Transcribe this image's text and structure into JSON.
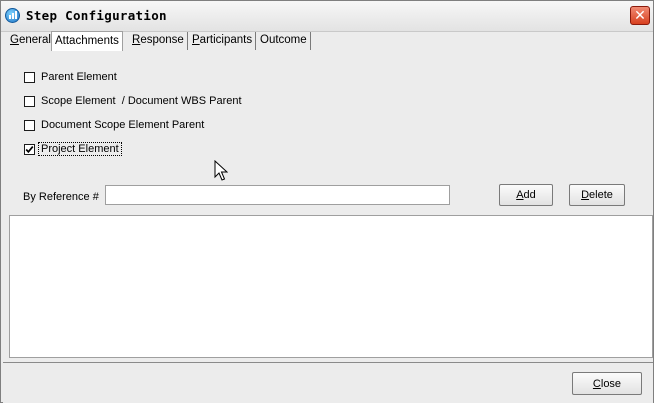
{
  "window": {
    "title": "Step Configuration",
    "close_glyph": "✕"
  },
  "tabs": [
    {
      "label": "General",
      "hotkey": "G",
      "rest": "eneral",
      "active": false
    },
    {
      "label": "Attachments",
      "hotkey": "",
      "rest": "Attachments",
      "active": true
    },
    {
      "label": "Response",
      "hotkey": "R",
      "rest": "esponse",
      "active": false
    },
    {
      "label": "Participants",
      "hotkey": "P",
      "rest": "articipants",
      "active": false
    },
    {
      "label": "Outcome",
      "hotkey": "",
      "rest": "Outcome",
      "active": false
    }
  ],
  "checkboxes": [
    {
      "label": "Parent Element",
      "checked": false
    },
    {
      "label": "Scope Element  / Document WBS Parent",
      "checked": false
    },
    {
      "label": "Document Scope Element Parent",
      "checked": false
    },
    {
      "label": "Project Element",
      "checked": true
    }
  ],
  "reference": {
    "label": "By Reference #",
    "value": ""
  },
  "buttons": {
    "add": {
      "hotkey": "A",
      "rest": "dd"
    },
    "delete": {
      "hotkey": "D",
      "rest": "elete"
    },
    "close": {
      "hotkey": "C",
      "rest": "lose"
    }
  },
  "colors": {
    "close_button": "#d8401f",
    "window_bg": "#ececec"
  }
}
